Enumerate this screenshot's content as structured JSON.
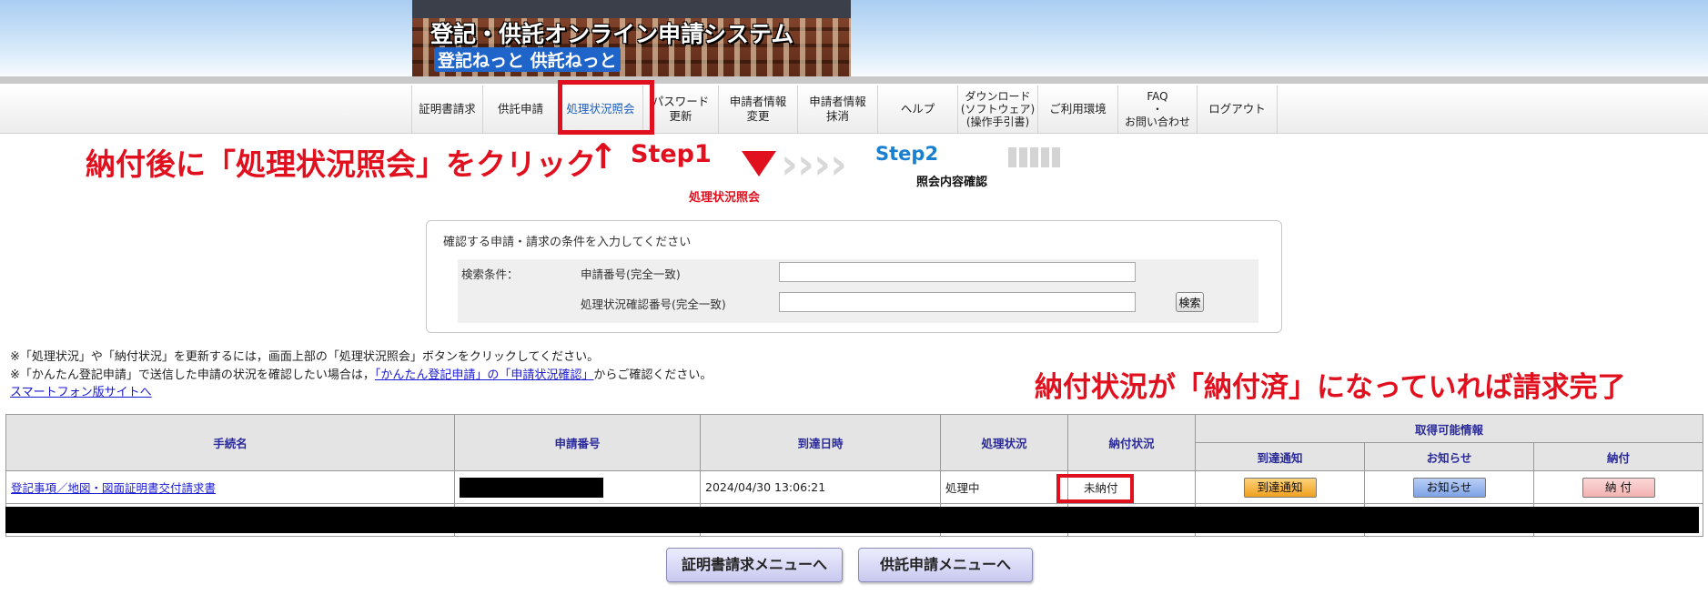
{
  "banner": {
    "title": "登記・供託オンライン申請システム",
    "subtitle": "登記ねっと 供託ねっと"
  },
  "nav": [
    {
      "label": "証明書請求",
      "active": false
    },
    {
      "label": "供託申請",
      "active": false
    },
    {
      "label": "処理状況照会",
      "active": true
    },
    {
      "label": "パスワード\n更新",
      "active": false
    },
    {
      "label": "申請者情報\n変更",
      "active": false
    },
    {
      "label": "申請者情報\n抹消",
      "active": false
    },
    {
      "label": "ヘルプ",
      "active": false
    },
    {
      "label": "ダウンロード\n(ソフトウェア)\n(操作手引書)",
      "active": false
    },
    {
      "label": "ご利用環境",
      "active": false
    },
    {
      "label": "FAQ\n・\nお問い合わせ",
      "active": false
    },
    {
      "label": "ログアウト",
      "active": false
    }
  ],
  "annotations": {
    "click_instruction": "納付後に「処理状況照会」をクリック",
    "arrow": "↑",
    "step1": "Step1",
    "step1_caption": "処理状況照会",
    "step2": "Step2",
    "step2_caption": "照会内容確認",
    "payment_note": "納付状況が「納付済」になっていれば請求完了"
  },
  "search": {
    "panel_title": "確認する申請・請求の条件を入力してください",
    "criteria_label": "検索条件：",
    "field1_label": "申請番号(完全一致)",
    "field1_value": "",
    "field2_label": "処理状況確認番号(完全一致)",
    "field2_value": "",
    "search_button": "検索"
  },
  "notes": {
    "line1": "※「処理状況」や「納付状況」を更新するには，画面上部の「処理状況照会」ボタンをクリックしてください。",
    "line2_prefix": "※「かんたん登記申請」で送信した申請の状況を確認したい場合は，",
    "line2_link": "「かんたん登記申請」の「申請状況確認」",
    "line2_suffix": "からご確認ください。",
    "smartphone_link": "スマートフォン版サイトへ"
  },
  "table": {
    "headers": {
      "procedure": "手続名",
      "application_no": "申請番号",
      "arrival": "到達日時",
      "process_status": "処理状況",
      "payment_status": "納付状況",
      "available_info": "取得可能情報",
      "arrival_notice": "到達通知",
      "notice": "お知らせ",
      "payment": "納付"
    },
    "row": {
      "procedure": "登記事項／地図・図面証明書交付請求書",
      "arrival": "2024/04/30 13:06:21",
      "process_status": "処理中",
      "payment_status": "未納付",
      "btn_arrival_notice": "到達通知",
      "btn_notice": "お知らせ",
      "btn_payment": "納 付"
    }
  },
  "bottom": {
    "cert_menu": "証明書請求メニューへ",
    "deposit_menu": "供託申請メニューへ"
  },
  "colors": {
    "annotation_red": "#e0101e",
    "step2_blue": "#1a7fd0",
    "header_text": "#2a2a9a"
  }
}
